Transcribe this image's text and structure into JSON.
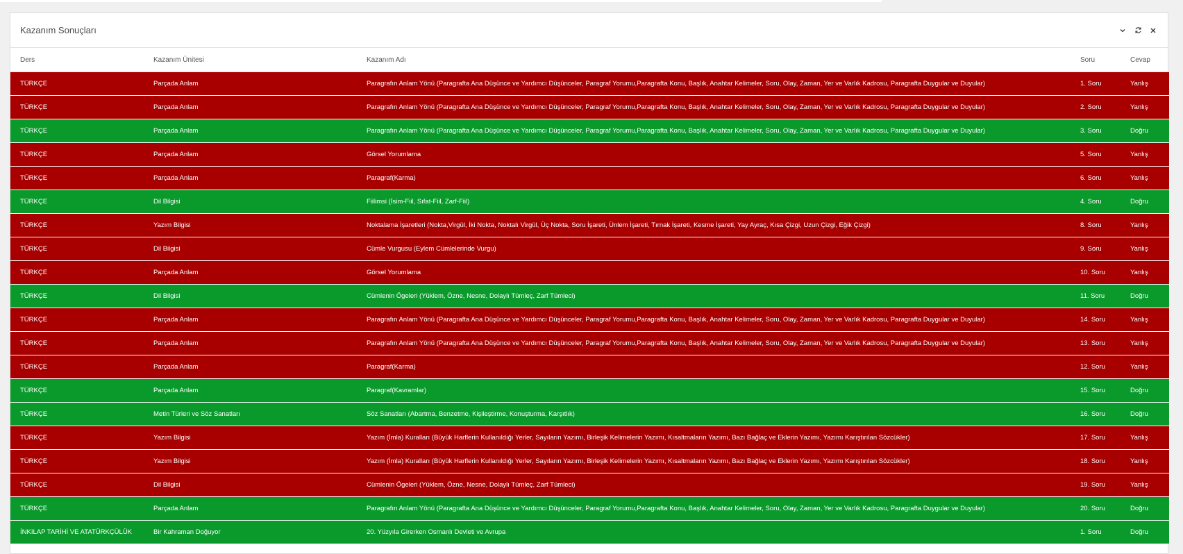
{
  "panel": {
    "title": "Kazanım Sonuçları",
    "icons": [
      "chevron-down-icon",
      "refresh-icon",
      "close-icon"
    ]
  },
  "table": {
    "headers": {
      "ders": "Ders",
      "unite": "Kazanım Ünitesi",
      "ad": "Kazanım Adı",
      "soru": "Soru",
      "cevap": "Cevap"
    },
    "colors": {
      "wrong": "#a80000",
      "correct": "#0a9a2c"
    },
    "rows": [
      {
        "ders": "TÜRKÇE",
        "unite": "Parçada Anlam",
        "ad": "Paragrafın Anlam Yönü (Paragrafta Ana Düşünce ve Yardımcı Düşünceler, Paragraf Yorumu,Paragrafta Konu, Başlık, Anahtar Kelimeler, Soru, Olay, Zaman, Yer ve Varlık Kadrosu, Paragrafta Duygular ve Duyular)",
        "soru": "1. Soru",
        "cevap": "Yanlış",
        "status": "wrong"
      },
      {
        "ders": "TÜRKÇE",
        "unite": "Parçada Anlam",
        "ad": "Paragrafın Anlam Yönü (Paragrafta Ana Düşünce ve Yardımcı Düşünceler, Paragraf Yorumu,Paragrafta Konu, Başlık, Anahtar Kelimeler, Soru, Olay, Zaman, Yer ve Varlık Kadrosu, Paragrafta Duygular ve Duyular)",
        "soru": "2. Soru",
        "cevap": "Yanlış",
        "status": "wrong"
      },
      {
        "ders": "TÜRKÇE",
        "unite": "Parçada Anlam",
        "ad": "Paragrafın Anlam Yönü (Paragrafta Ana Düşünce ve Yardımcı Düşünceler, Paragraf Yorumu,Paragrafta Konu, Başlık, Anahtar Kelimeler, Soru, Olay, Zaman, Yer ve Varlık Kadrosu, Paragrafta Duygular ve Duyular)",
        "soru": "3. Soru",
        "cevap": "Doğru",
        "status": "correct"
      },
      {
        "ders": "TÜRKÇE",
        "unite": "Parçada Anlam",
        "ad": "Görsel Yorumlama",
        "soru": "5. Soru",
        "cevap": "Yanlış",
        "status": "wrong"
      },
      {
        "ders": "TÜRKÇE",
        "unite": "Parçada Anlam",
        "ad": "Paragraf(Karma)",
        "soru": "6. Soru",
        "cevap": "Yanlış",
        "status": "wrong"
      },
      {
        "ders": "TÜRKÇE",
        "unite": "Dil Bilgisi",
        "ad": "Fiilimsi (İsim-Fiil, Sıfat-Fiil, Zarf-Fiil)",
        "soru": "4. Soru",
        "cevap": "Doğru",
        "status": "correct"
      },
      {
        "ders": "TÜRKÇE",
        "unite": "Yazım Bilgisi",
        "ad": "Noktalama İşaretleri (Nokta,Virgül, İki Nokta, Noktalı Virgül, Üç Nokta, Soru İşareti, Ünlem İşareti, Tırnak İşareti, Kesme İşareti, Yay Ayraç, Kısa Çizgi, Uzun Çizgi, Eğik Çizgi)",
        "soru": "8. Soru",
        "cevap": "Yanlış",
        "status": "wrong"
      },
      {
        "ders": "TÜRKÇE",
        "unite": "Dil Bilgisi",
        "ad": "Cümle Vurgusu (Eylem Cümlelerinde Vurgu)",
        "soru": "9. Soru",
        "cevap": "Yanlış",
        "status": "wrong"
      },
      {
        "ders": "TÜRKÇE",
        "unite": "Parçada Anlam",
        "ad": "Görsel Yorumlama",
        "soru": "10. Soru",
        "cevap": "Yanlış",
        "status": "wrong"
      },
      {
        "ders": "TÜRKÇE",
        "unite": "Dil Bilgisi",
        "ad": "Cümlenin Ögeleri (Yüklem, Özne, Nesne, Dolaylı Tümleç, Zarf Tümleci)",
        "soru": "11. Soru",
        "cevap": "Doğru",
        "status": "correct"
      },
      {
        "ders": "TÜRKÇE",
        "unite": "Parçada Anlam",
        "ad": "Paragrafın Anlam Yönü (Paragrafta Ana Düşünce ve Yardımcı Düşünceler, Paragraf Yorumu,Paragrafta Konu, Başlık, Anahtar Kelimeler, Soru, Olay, Zaman, Yer ve Varlık Kadrosu, Paragrafta Duygular ve Duyular)",
        "soru": "14. Soru",
        "cevap": "Yanlış",
        "status": "wrong"
      },
      {
        "ders": "TÜRKÇE",
        "unite": "Parçada Anlam",
        "ad": "Paragrafın Anlam Yönü (Paragrafta Ana Düşünce ve Yardımcı Düşünceler, Paragraf Yorumu,Paragrafta Konu, Başlık, Anahtar Kelimeler, Soru, Olay, Zaman, Yer ve Varlık Kadrosu, Paragrafta Duygular ve Duyular)",
        "soru": "13. Soru",
        "cevap": "Yanlış",
        "status": "wrong"
      },
      {
        "ders": "TÜRKÇE",
        "unite": "Parçada Anlam",
        "ad": "Paragraf(Karma)",
        "soru": "12. Soru",
        "cevap": "Yanlış",
        "status": "wrong"
      },
      {
        "ders": "TÜRKÇE",
        "unite": "Parçada Anlam",
        "ad": "Paragraf(Kavramlar)",
        "soru": "15. Soru",
        "cevap": "Doğru",
        "status": "correct"
      },
      {
        "ders": "TÜRKÇE",
        "unite": "Metin Türleri ve Söz Sanatları",
        "ad": "Söz Sanatları (Abartma, Benzetme, Kişileştirme, Konuşturma, Karşıtlık)",
        "soru": "16. Soru",
        "cevap": "Doğru",
        "status": "correct"
      },
      {
        "ders": "TÜRKÇE",
        "unite": "Yazım Bilgisi",
        "ad": "Yazım (İmla) Kuralları (Büyük Harflerin Kullanıldığı Yerler, Sayıların Yazımı, Birleşik Kelimelerin Yazımı, Kısaltmaların Yazımı, Bazı Bağlaç ve Eklerin Yazımı, Yazımı Karıştırılan Sözcükler)",
        "soru": "17. Soru",
        "cevap": "Yanlış",
        "status": "wrong"
      },
      {
        "ders": "TÜRKÇE",
        "unite": "Yazım Bilgisi",
        "ad": "Yazım (İmla) Kuralları (Büyük Harflerin Kullanıldığı Yerler, Sayıların Yazımı, Birleşik Kelimelerin Yazımı, Kısaltmaların Yazımı, Bazı Bağlaç ve Eklerin Yazımı, Yazımı Karıştırılan Sözcükler)",
        "soru": "18. Soru",
        "cevap": "Yanlış",
        "status": "wrong"
      },
      {
        "ders": "TÜRKÇE",
        "unite": "Dil Bilgisi",
        "ad": "Cümlenin Ögeleri (Yüklem, Özne, Nesne, Dolaylı Tümleç, Zarf Tümleci)",
        "soru": "19. Soru",
        "cevap": "Yanlış",
        "status": "wrong"
      },
      {
        "ders": "TÜRKÇE",
        "unite": "Parçada Anlam",
        "ad": "Paragrafın Anlam Yönü (Paragrafta Ana Düşünce ve Yardımcı Düşünceler, Paragraf Yorumu,Paragrafta Konu, Başlık, Anahtar Kelimeler, Soru, Olay, Zaman, Yer ve Varlık Kadrosu, Paragrafta Duygular ve Duyular)",
        "soru": "20. Soru",
        "cevap": "Doğru",
        "status": "correct"
      },
      {
        "ders": "İNKILAP TARİHİ VE ATATÜRKÇÜLÜK",
        "unite": "Bir Kahraman Doğuyor",
        "ad": "20. Yüzyıla Girerken Osmanlı Devleti ve Avrupa",
        "soru": "1. Soru",
        "cevap": "Doğru",
        "status": "correct"
      }
    ]
  }
}
